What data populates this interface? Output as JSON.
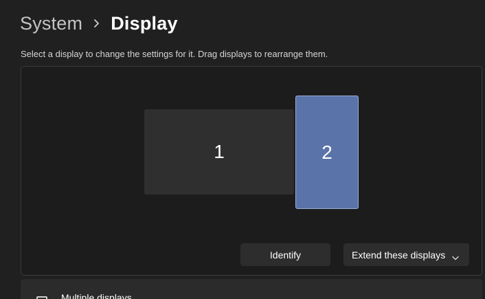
{
  "breadcrumb": {
    "parent": "System",
    "separator_icon": "chevron-right-icon",
    "current": "Display"
  },
  "instruction": "Select a display to change the settings for it. Drag displays to rearrange them.",
  "displays": [
    {
      "label": "1",
      "selected": false
    },
    {
      "label": "2",
      "selected": true
    }
  ],
  "actions": {
    "identify_label": "Identify",
    "mode_value": "Extend these displays",
    "mode_icon": "chevron-down-icon"
  },
  "multiple_displays": {
    "label": "Multiple displays",
    "icon": "multiple-displays-icon"
  },
  "colors": {
    "background": "#202020",
    "panel": "#1c1c1c",
    "selected_display": "#5a74a9",
    "unselected_display": "#2f2f2f"
  }
}
